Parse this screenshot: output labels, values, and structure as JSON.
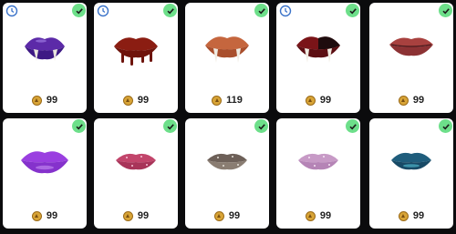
{
  "items": [
    {
      "prices": "99",
      "name": "purple-fang-lips-icon"
    },
    {
      "prices": "99",
      "name": "dripping-blood-lips-icon"
    },
    {
      "prices": "119",
      "name": "nude-fang-lips-icon"
    },
    {
      "prices": "99",
      "name": "dark-red-fang-lips-icon"
    },
    {
      "prices": "99",
      "name": "rose-lips-icon"
    },
    {
      "prices": "99",
      "name": "violet-lips-icon"
    },
    {
      "prices": "99",
      "name": "pink-glitter-lips-icon"
    },
    {
      "prices": "99",
      "name": "silver-glitter-lips-icon"
    },
    {
      "prices": "99",
      "name": "lilac-glitter-lips-icon"
    },
    {
      "prices": "99",
      "name": "teal-lips-icon"
    }
  ],
  "colors": {
    "owned_check": "#6ddf8a",
    "timer": "#3b73c9",
    "coin": "#d8a437"
  }
}
